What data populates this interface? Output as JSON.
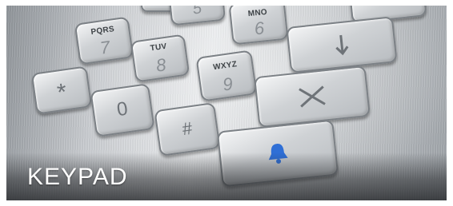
{
  "caption": "KEYPAD",
  "keys": {
    "five": {
      "digit": "5"
    },
    "six": {
      "letters": "MNO",
      "digit": "6"
    },
    "seven": {
      "letters": "PQRS",
      "digit": "7"
    },
    "eight": {
      "letters": "TUV",
      "digit": "8"
    },
    "nine": {
      "letters": "WXYZ",
      "digit": "9"
    },
    "star": {
      "symbol": "*"
    },
    "zero": {
      "digit": "0"
    },
    "hash": {
      "symbol": "#"
    }
  },
  "function_keys": {
    "down_arrow": {
      "icon": "down-arrow-icon"
    },
    "cancel": {
      "icon": "x-icon"
    },
    "bell": {
      "icon": "bell-icon",
      "color": "#2f6fd6"
    }
  }
}
